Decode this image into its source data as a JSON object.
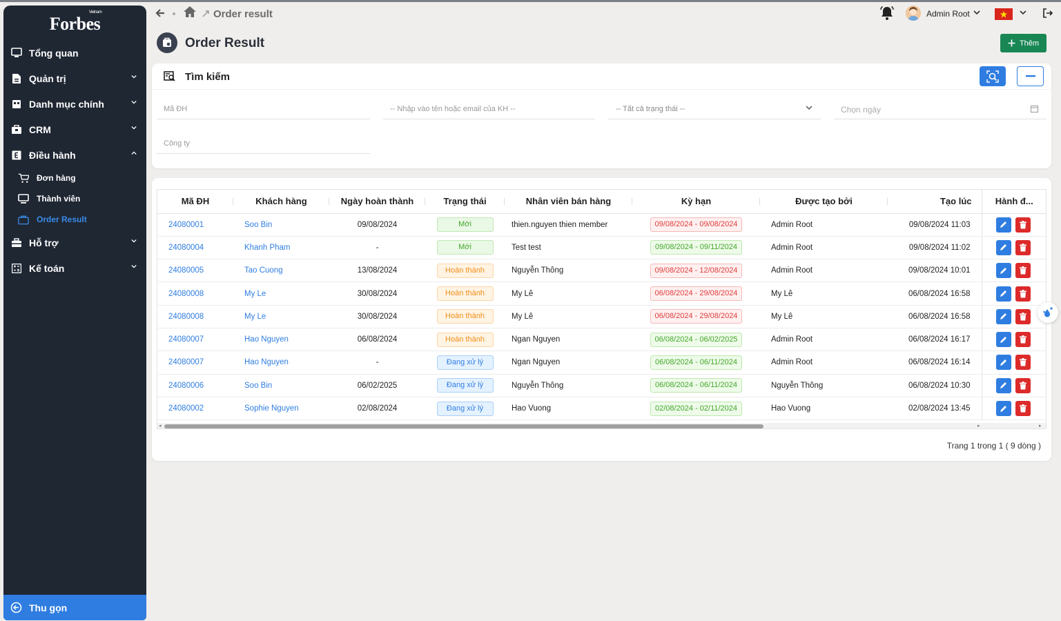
{
  "brand": {
    "logo": "Forbes",
    "logo_sub": "Vietnam"
  },
  "sidebar": {
    "items": [
      {
        "label": "Tổng quan",
        "icon": "monitor-icon"
      },
      {
        "label": "Quản trị",
        "icon": "document-icon"
      },
      {
        "label": "Danh mục chính",
        "icon": "grid-icon"
      },
      {
        "label": "CRM",
        "icon": "briefcase-icon"
      },
      {
        "label": "Điều hành",
        "icon": "e-square-icon"
      },
      {
        "label": "Hỗ trợ",
        "icon": "toolbox-icon"
      },
      {
        "label": "Kế toán",
        "icon": "calculator-icon"
      }
    ],
    "sub_items": [
      {
        "label": "Đơn hàng",
        "icon": "cart-icon"
      },
      {
        "label": "Thành viên",
        "icon": "monitor-icon"
      },
      {
        "label": "Order Result",
        "icon": "bag-icon"
      }
    ],
    "collapse_label": "Thu gọn"
  },
  "header": {
    "breadcrumb": "Order result",
    "user_name": "Admin Root"
  },
  "page": {
    "title": "Order Result",
    "add_label": "Thêm"
  },
  "search": {
    "title": "Tìm kiếm",
    "order_code_placeholder": "Mã ĐH",
    "customer_placeholder": "-- Nhập vào tên hoặc email của KH --",
    "status_placeholder": "-- Tất cả trạng thái --",
    "date_placeholder": "Chọn ngày",
    "company_placeholder": "Công ty"
  },
  "table": {
    "headers": [
      "Mã ĐH",
      "Khách hàng",
      "Ngày hoàn thành",
      "Trạng thái",
      "Nhân viên bán hàng",
      "Kỳ hạn",
      "Được tạo bởi",
      "Tạo lúc",
      "Hành đ..."
    ],
    "rows": [
      {
        "code": "24080001",
        "customer": "Soo Bin",
        "completed": "09/08/2024",
        "status": "Mới",
        "status_type": "new",
        "staff": "thien.nguyen thien member",
        "term": "09/08/2024 - 09/08/2024",
        "term_color": "red",
        "created_by": "Admin Root",
        "created_at": "09/08/2024 11:03"
      },
      {
        "code": "24080004",
        "customer": "Khanh Pham",
        "completed": "-",
        "status": "Mới",
        "status_type": "new",
        "staff": "Test test",
        "term": "09/08/2024 - 09/11/2024",
        "term_color": "green",
        "created_by": "Admin Root",
        "created_at": "09/08/2024 11:02"
      },
      {
        "code": "24080005",
        "customer": "Tao Cuong",
        "completed": "13/08/2024",
        "status": "Hoàn thành",
        "status_type": "done",
        "staff": "Nguyễn Thông",
        "term": "09/08/2024 - 12/08/2024",
        "term_color": "red",
        "created_by": "Admin Root",
        "created_at": "09/08/2024 10:01"
      },
      {
        "code": "24080008",
        "customer": "My Le",
        "completed": "30/08/2024",
        "status": "Hoàn thành",
        "status_type": "done",
        "staff": "My Lê",
        "term": "06/08/2024 - 29/08/2024",
        "term_color": "red",
        "created_by": "My Lê",
        "created_at": "06/08/2024 16:58"
      },
      {
        "code": "24080008",
        "customer": "My Le",
        "completed": "30/08/2024",
        "status": "Hoàn thành",
        "status_type": "done",
        "staff": "My Lê",
        "term": "06/08/2024 - 29/08/2024",
        "term_color": "red",
        "created_by": "My Lê",
        "created_at": "06/08/2024 16:58"
      },
      {
        "code": "24080007",
        "customer": "Hao Nguyen",
        "completed": "06/08/2024",
        "status": "Hoàn thành",
        "status_type": "done",
        "staff": "Ngan Nguyen",
        "term": "06/08/2024 - 06/02/2025",
        "term_color": "green",
        "created_by": "Admin Root",
        "created_at": "06/08/2024 16:17"
      },
      {
        "code": "24080007",
        "customer": "Hao Nguyen",
        "completed": "-",
        "status": "Đang xử lý",
        "status_type": "proc",
        "staff": "Ngan Nguyen",
        "term": "06/08/2024 - 06/11/2024",
        "term_color": "green",
        "created_by": "Admin Root",
        "created_at": "06/08/2024 16:14"
      },
      {
        "code": "24080006",
        "customer": "Soo Bin",
        "completed": "06/02/2025",
        "status": "Đang xử lý",
        "status_type": "proc",
        "staff": "Nguyễn Thông",
        "term": "06/08/2024 - 06/11/2024",
        "term_color": "green",
        "created_by": "Nguyễn Thông",
        "created_at": "06/08/2024 10:30"
      },
      {
        "code": "24080002",
        "customer": "Sophie Nguyen",
        "completed": "02/08/2024",
        "status": "Đang xử lý",
        "status_type": "proc",
        "staff": "Hao Vuong",
        "term": "02/08/2024 - 02/11/2024",
        "term_color": "green",
        "created_by": "Hao Vuong",
        "created_at": "02/08/2024 13:45"
      }
    ]
  },
  "pagination": {
    "text": "Trang 1 trong 1 ( 9 dòng )"
  },
  "colors": {
    "sidebar_bg": "#1f2733",
    "accent": "#2f7de1",
    "add_button": "#198754",
    "delete": "#dd2a2a"
  }
}
